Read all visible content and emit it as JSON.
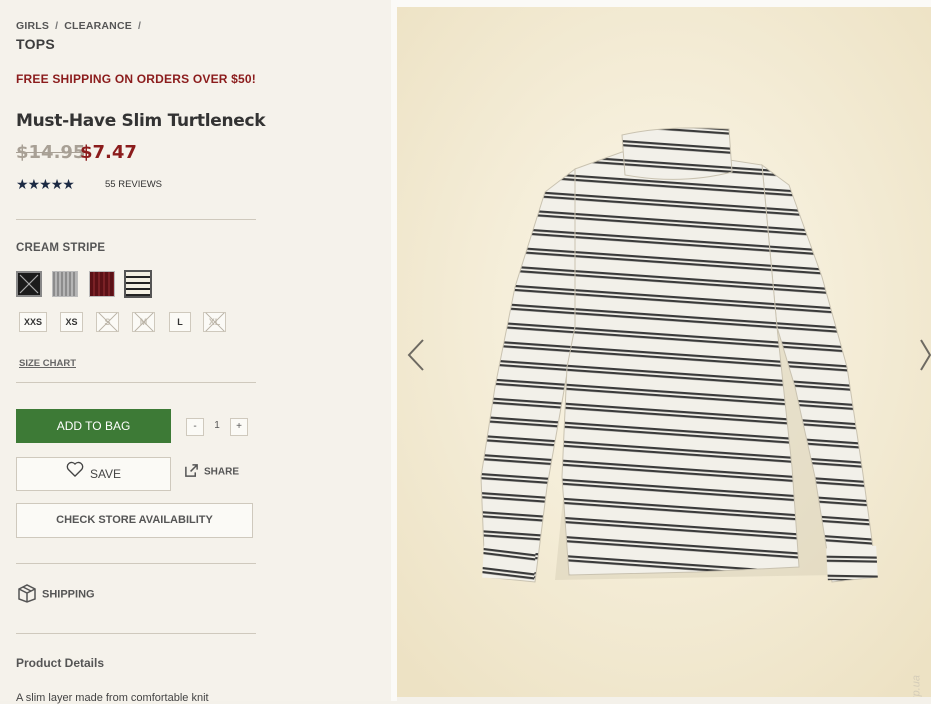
{
  "breadcrumb": {
    "items": [
      "GIRLS",
      "CLEARANCE"
    ],
    "current": "TOPS"
  },
  "promo": "FREE SHIPPING ON ORDERS OVER $50!",
  "product": {
    "name": "Must-Have Slim Turtleneck",
    "price_old": "$14.95",
    "price_new": "$7.47",
    "rating": 5,
    "reviews": "55 REVIEWS"
  },
  "colors": {
    "selected_label": "CREAM STRIPE",
    "swatches": [
      "black",
      "heather-grey",
      "burgundy",
      "cream-stripe"
    ]
  },
  "sizes": [
    {
      "label": "XXS",
      "available": true
    },
    {
      "label": "XS",
      "available": true
    },
    {
      "label": "S",
      "available": false
    },
    {
      "label": "M",
      "available": false
    },
    {
      "label": "L",
      "available": true
    },
    {
      "label": "XL",
      "available": false
    }
  ],
  "size_chart": "SIZE CHART",
  "actions": {
    "add_to_bag": "ADD TO BAG",
    "qty_minus": "-",
    "qty_value": "1",
    "qty_plus": "+",
    "save": "SAVE",
    "share": "SHARE",
    "check_store": "CHECK STORE AVAILABILITY"
  },
  "shipping_label": "SHIPPING",
  "details": {
    "heading": "Product Details",
    "description": "A slim layer made from comfortable knit"
  },
  "gallery": {
    "watermark": "ladies.kp.ua",
    "icons": [
      "chevron-left-icon",
      "chevron-right-icon"
    ]
  },
  "colors_theme": {
    "accent_red": "#8b1c1c",
    "accent_green": "#3d7a36",
    "star_navy": "#1c2a43"
  }
}
